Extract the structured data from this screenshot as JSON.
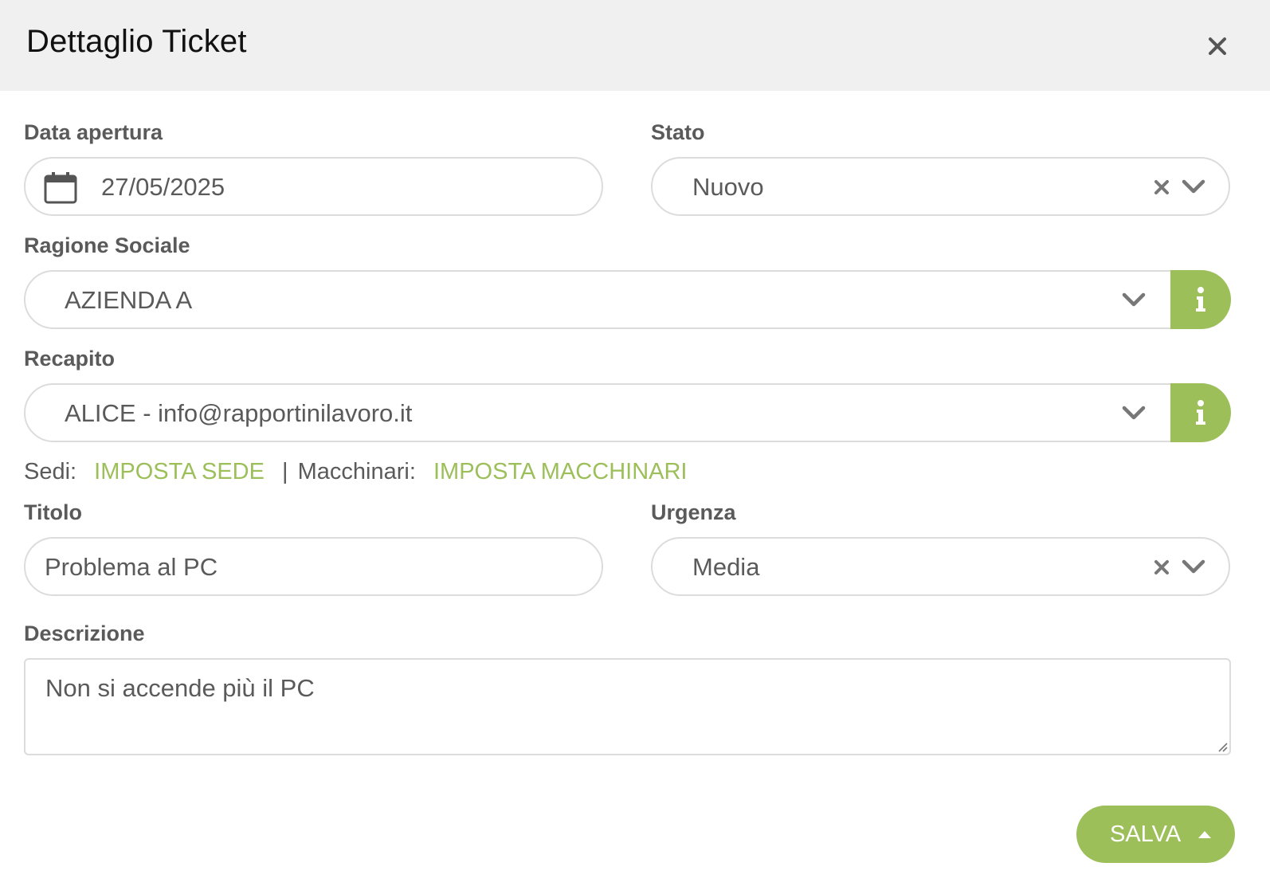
{
  "header": {
    "title": "Dettaglio Ticket"
  },
  "fields": {
    "data_apertura": {
      "label": "Data apertura",
      "value": "27/05/2025"
    },
    "stato": {
      "label": "Stato",
      "value": "Nuovo"
    },
    "ragione_sociale": {
      "label": "Ragione Sociale",
      "value": "AZIENDA A"
    },
    "recapito": {
      "label": "Recapito",
      "value": "ALICE - info@rapportinilavoro.it"
    },
    "titolo": {
      "label": "Titolo",
      "value": "Problema al PC"
    },
    "urgenza": {
      "label": "Urgenza",
      "value": "Media"
    },
    "descrizione": {
      "label": "Descrizione",
      "value": "Non si accende più il PC"
    }
  },
  "links": {
    "sedi_label": "Sedi:",
    "sedi_link": "IMPOSTA SEDE",
    "separator": "|",
    "macchinari_label": "Macchinari:",
    "macchinari_link": "IMPOSTA MACCHINARI"
  },
  "actions": {
    "save_label": "SALVA"
  },
  "colors": {
    "accent": "#9cbf5a",
    "header_bg": "#f0f0f0",
    "border": "#dcdcdc"
  },
  "icons": [
    "close-icon",
    "calendar-icon",
    "clear-icon",
    "chevron-down-icon",
    "info-icon",
    "caret-up-icon",
    "resize-grip-icon"
  ]
}
